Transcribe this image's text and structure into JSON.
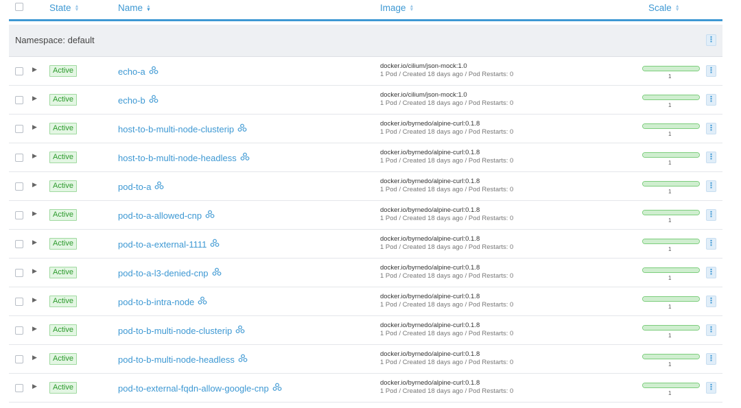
{
  "table": {
    "columns": {
      "state": "State",
      "name": "Name",
      "image": "Image",
      "scale": "Scale"
    }
  },
  "group": {
    "label": "Namespace: default"
  },
  "icons": {
    "sort": "sort-icon",
    "expand": "expand-arrow-icon",
    "workload": "workload-cluster-icon",
    "menu": "kebab-menu-icon"
  },
  "colors": {
    "accent": "#3d98d3",
    "active": "#2c9a2c",
    "active_bg": "#e3f6e3"
  },
  "rows": [
    {
      "state": "Active",
      "name": "echo-a",
      "image": "docker.io/cilium/json-mock:1.0",
      "detail": "1 Pod / Created 18 days ago / Pod Restarts: 0",
      "scale": "1",
      "scale_fraction": 1.0
    },
    {
      "state": "Active",
      "name": "echo-b",
      "image": "docker.io/cilium/json-mock:1.0",
      "detail": "1 Pod / Created 18 days ago / Pod Restarts: 0",
      "scale": "1",
      "scale_fraction": 1.0
    },
    {
      "state": "Active",
      "name": "host-to-b-multi-node-clusterip",
      "image": "docker.io/byrnedo/alpine-curl:0.1.8",
      "detail": "1 Pod / Created 18 days ago / Pod Restarts: 0",
      "scale": "1",
      "scale_fraction": 1.0
    },
    {
      "state": "Active",
      "name": "host-to-b-multi-node-headless",
      "image": "docker.io/byrnedo/alpine-curl:0.1.8",
      "detail": "1 Pod / Created 18 days ago / Pod Restarts: 0",
      "scale": "1",
      "scale_fraction": 1.0
    },
    {
      "state": "Active",
      "name": "pod-to-a",
      "image": "docker.io/byrnedo/alpine-curl:0.1.8",
      "detail": "1 Pod / Created 18 days ago / Pod Restarts: 0",
      "scale": "1",
      "scale_fraction": 1.0
    },
    {
      "state": "Active",
      "name": "pod-to-a-allowed-cnp",
      "image": "docker.io/byrnedo/alpine-curl:0.1.8",
      "detail": "1 Pod / Created 18 days ago / Pod Restarts: 0",
      "scale": "1",
      "scale_fraction": 1.0
    },
    {
      "state": "Active",
      "name": "pod-to-a-external-1111",
      "image": "docker.io/byrnedo/alpine-curl:0.1.8",
      "detail": "1 Pod / Created 18 days ago / Pod Restarts: 0",
      "scale": "1",
      "scale_fraction": 1.0
    },
    {
      "state": "Active",
      "name": "pod-to-a-l3-denied-cnp",
      "image": "docker.io/byrnedo/alpine-curl:0.1.8",
      "detail": "1 Pod / Created 18 days ago / Pod Restarts: 0",
      "scale": "1",
      "scale_fraction": 1.0
    },
    {
      "state": "Active",
      "name": "pod-to-b-intra-node",
      "image": "docker.io/byrnedo/alpine-curl:0.1.8",
      "detail": "1 Pod / Created 18 days ago / Pod Restarts: 0",
      "scale": "1",
      "scale_fraction": 1.0
    },
    {
      "state": "Active",
      "name": "pod-to-b-multi-node-clusterip",
      "image": "docker.io/byrnedo/alpine-curl:0.1.8",
      "detail": "1 Pod / Created 18 days ago / Pod Restarts: 0",
      "scale": "1",
      "scale_fraction": 1.0
    },
    {
      "state": "Active",
      "name": "pod-to-b-multi-node-headless",
      "image": "docker.io/byrnedo/alpine-curl:0.1.8",
      "detail": "1 Pod / Created 18 days ago / Pod Restarts: 0",
      "scale": "1",
      "scale_fraction": 1.0
    },
    {
      "state": "Active",
      "name": "pod-to-external-fqdn-allow-google-cnp",
      "image": "docker.io/byrnedo/alpine-curl:0.1.8",
      "detail": "1 Pod / Created 18 days ago / Pod Restarts: 0",
      "scale": "1",
      "scale_fraction": 1.0
    }
  ]
}
